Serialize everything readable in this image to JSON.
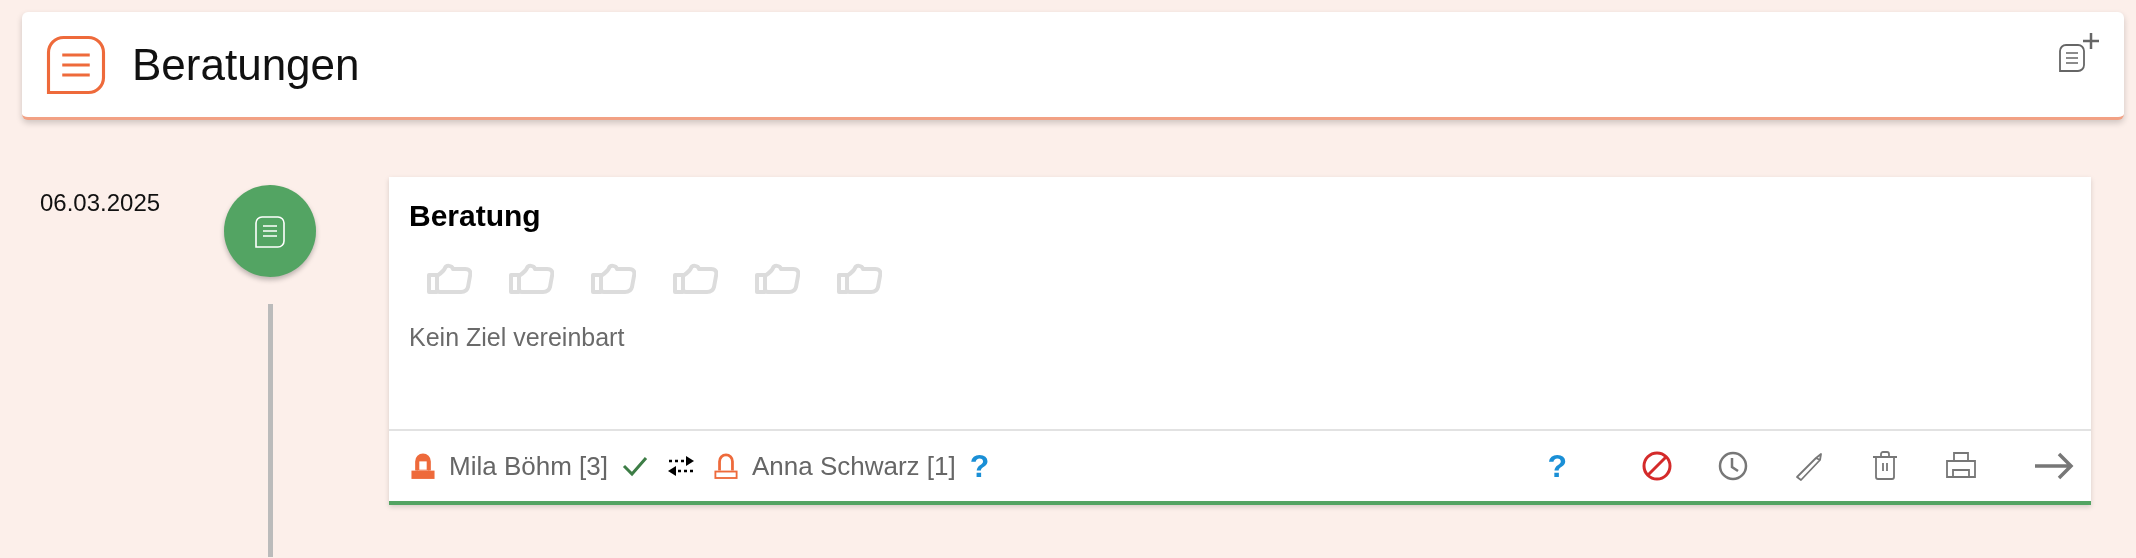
{
  "header": {
    "title": "Beratungen"
  },
  "entries": [
    {
      "date": "06.03.2025",
      "title": "Beratung",
      "stars": 0,
      "goal": "Kein Ziel vereinbart",
      "footer_left": [
        {
          "kind": "person",
          "label": "Mila Böhm [3]",
          "filled": true
        },
        {
          "kind": "check"
        },
        {
          "kind": "swap"
        },
        {
          "kind": "person",
          "label": "Anna Schwarz [1]",
          "filled": false
        },
        {
          "kind": "question",
          "label": "?"
        }
      ],
      "footer_right": [
        {
          "kind": "question",
          "label": "?"
        },
        {
          "kind": "blocked"
        },
        {
          "kind": "clock"
        },
        {
          "kind": "edit"
        },
        {
          "kind": "delete"
        },
        {
          "kind": "print"
        },
        {
          "kind": "next"
        }
      ]
    }
  ]
}
